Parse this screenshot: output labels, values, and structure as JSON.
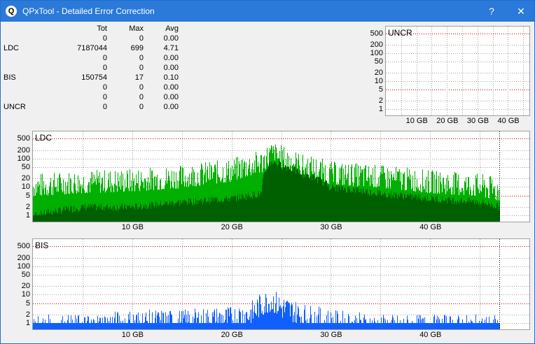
{
  "window": {
    "title": "QPxTool - Detailed Error Correction",
    "help_label": "?",
    "close_label": "✕",
    "app_icon_letter": "Q"
  },
  "stats": {
    "headers": {
      "tot": "Tot",
      "max": "Max",
      "avg": "Avg"
    },
    "rows": [
      {
        "label": "",
        "tot": "0",
        "max": "0",
        "avg": "0.00"
      },
      {
        "label": "LDC",
        "tot": "7187044",
        "max": "699",
        "avg": "4.71"
      },
      {
        "label": "",
        "tot": "0",
        "max": "0",
        "avg": "0.00"
      },
      {
        "label": "",
        "tot": "0",
        "max": "0",
        "avg": "0.00"
      },
      {
        "label": "BIS",
        "tot": "150754",
        "max": "17",
        "avg": "0.10"
      },
      {
        "label": "",
        "tot": "0",
        "max": "0",
        "avg": "0.00"
      },
      {
        "label": "",
        "tot": "0",
        "max": "0",
        "avg": "0.00"
      },
      {
        "label": "UNCR",
        "tot": "0",
        "max": "0",
        "avg": "0.00"
      }
    ]
  },
  "colors": {
    "ldc_bright": "#00b000",
    "ldc_dark": "#006000",
    "bis_bright": "#1060ff",
    "bis_dark": "#0a2a8a",
    "red_grid": "#c00000",
    "grid": "#a0a0a0"
  },
  "chart_data": [
    {
      "type": "bar",
      "title": "UNCR",
      "scale": "log",
      "y_ticks": [
        "500",
        "200",
        "100",
        "50",
        "20",
        "10",
        "5",
        "2",
        "1"
      ],
      "x_ticks": [
        "10 GB",
        "20 GB",
        "30 GB",
        "40 GB"
      ],
      "xlim": [
        0,
        47
      ],
      "series": []
    },
    {
      "type": "bar",
      "title": "LDC",
      "scale": "log",
      "y_ticks": [
        "500",
        "200",
        "100",
        "50",
        "20",
        "10",
        "5",
        "2",
        "1"
      ],
      "x_ticks": [
        "10 GB",
        "20 GB",
        "30 GB",
        "40 GB"
      ],
      "xlim": [
        0,
        50
      ],
      "series": [
        {
          "x": [
            0,
            5,
            10,
            15,
            20,
            23,
            24,
            25,
            27,
            30,
            35,
            40,
            45,
            47
          ],
          "peak": [
            30,
            40,
            45,
            60,
            100,
            200,
            400,
            300,
            150,
            80,
            60,
            40,
            30,
            20
          ],
          "base": [
            1,
            2,
            2,
            3,
            4,
            6,
            80,
            60,
            30,
            10,
            6,
            4,
            3,
            2
          ]
        }
      ]
    },
    {
      "type": "bar",
      "title": "BIS",
      "scale": "log",
      "y_ticks": [
        "500",
        "200",
        "100",
        "50",
        "20",
        "10",
        "5",
        "2",
        "1"
      ],
      "x_ticks": [
        "10 GB",
        "20 GB",
        "30 GB",
        "40 GB"
      ],
      "xlim": [
        0,
        50
      ],
      "series": [
        {
          "x": [
            0,
            5,
            10,
            15,
            20,
            22,
            23,
            24,
            25,
            27,
            30,
            35,
            40,
            45,
            47
          ],
          "peak": [
            2,
            2,
            3,
            3,
            4,
            6,
            12,
            17,
            10,
            5,
            3,
            2,
            2,
            2,
            2
          ]
        }
      ]
    }
  ]
}
